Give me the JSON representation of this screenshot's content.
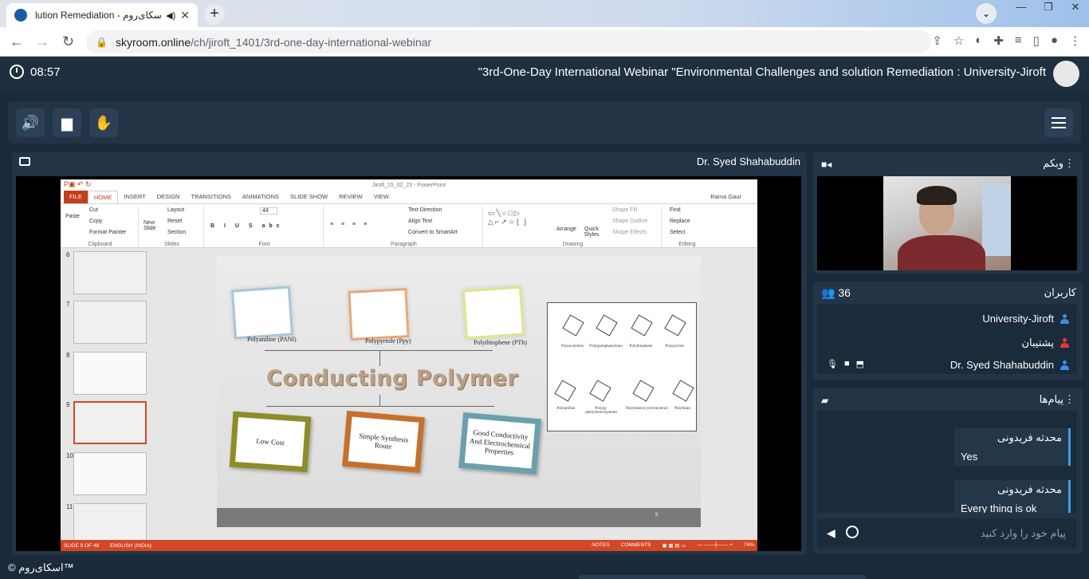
{
  "browser": {
    "tab_title": "lution Remediation - اسکای‌روم",
    "url_host": "skyroom.online",
    "url_path": "/ch/jiroft_1401/3rd-one-day-international-webinar"
  },
  "header": {
    "time": "08:57",
    "webinar_title": "\"3rd-One-Day International Webinar \"Environmental Challenges and solution Remediation : University-Jiroft"
  },
  "presentation": {
    "presenter": "Dr. Syed Shahabuddin",
    "ppt_window_title": "Jiroft_15_02_23 - PowerPoint",
    "ppt_user": "Rama Gaur",
    "tabs": [
      "FILE",
      "HOME",
      "INSERT",
      "DESIGN",
      "TRANSITIONS",
      "ANIMATIONS",
      "SLIDE SHOW",
      "REVIEW",
      "VIEW"
    ],
    "ribbon": {
      "clipboard": {
        "label": "Clipboard",
        "paste": "Paste",
        "cut": "Cut",
        "copy": "Copy",
        "format_painter": "Format Painter"
      },
      "slides": {
        "label": "Slides",
        "new_slide": "New Slide",
        "layout": "Layout",
        "reset": "Reset",
        "section": "Section"
      },
      "font": {
        "label": "Font",
        "size": "44"
      },
      "paragraph": {
        "label": "Paragraph",
        "text_direction": "Text Direction",
        "align_text": "Align Text",
        "convert": "Convert to SmartArt"
      },
      "drawing": {
        "label": "Drawing",
        "arrange": "Arrange",
        "quick_styles": "Quick Styles",
        "shape_fill": "Shape Fill",
        "shape_outline": "Shape Outline",
        "shape_effects": "Shape Effects"
      },
      "editing": {
        "label": "Editing",
        "find": "Find",
        "replace": "Replace",
        "select": "Select"
      }
    },
    "thumb_numbers": [
      "6",
      "7",
      "8",
      "9",
      "10",
      "11"
    ],
    "slide": {
      "title": "Conducting Polymer",
      "polymers": [
        "Polyaniline (PANI)",
        "Polypyrrole (Ppy)",
        "Polythiophene (PTh)"
      ],
      "boxes": [
        "Low Cost",
        "Simple Synthesis Route",
        "Good Conductivity And Electrochemical Properties"
      ],
      "chem_labels": [
        "Polyacetylene",
        "Poly(paraphenylene)",
        "Polythiophene",
        "Polypyrrole",
        "Polyaniline",
        "Poly(p-phenylenevinylene)",
        "Poly(heterocyclevinylene)",
        "Polyfuran"
      ],
      "page_number": "9"
    },
    "status": {
      "slide_of": "SLIDE 9 OF 48",
      "language": "ENGLISH (INDIA)",
      "notes": "NOTES",
      "comments": "COMMENTS",
      "zoom": "74%"
    }
  },
  "webcam": {
    "title": "وبکم"
  },
  "users": {
    "title": "کاربران",
    "count": "36",
    "list": [
      {
        "name": "University-Jiroft",
        "color": "#3a8ee6"
      },
      {
        "name": "پشتیبان",
        "color": "#e53935"
      },
      {
        "name": "Dr. Syed Shahabuddin",
        "color": "#3a8ee6"
      }
    ]
  },
  "chat": {
    "title": "پیام‌ها",
    "messages": [
      {
        "sender": "محدثه فریدونی",
        "text": "Yes"
      },
      {
        "sender": "محدثه فریدونی",
        "text": "Every thing is ok"
      }
    ],
    "placeholder": "پیام خود را وارد کنید"
  },
  "footer": {
    "brand": "© اسکای‌روم™"
  }
}
